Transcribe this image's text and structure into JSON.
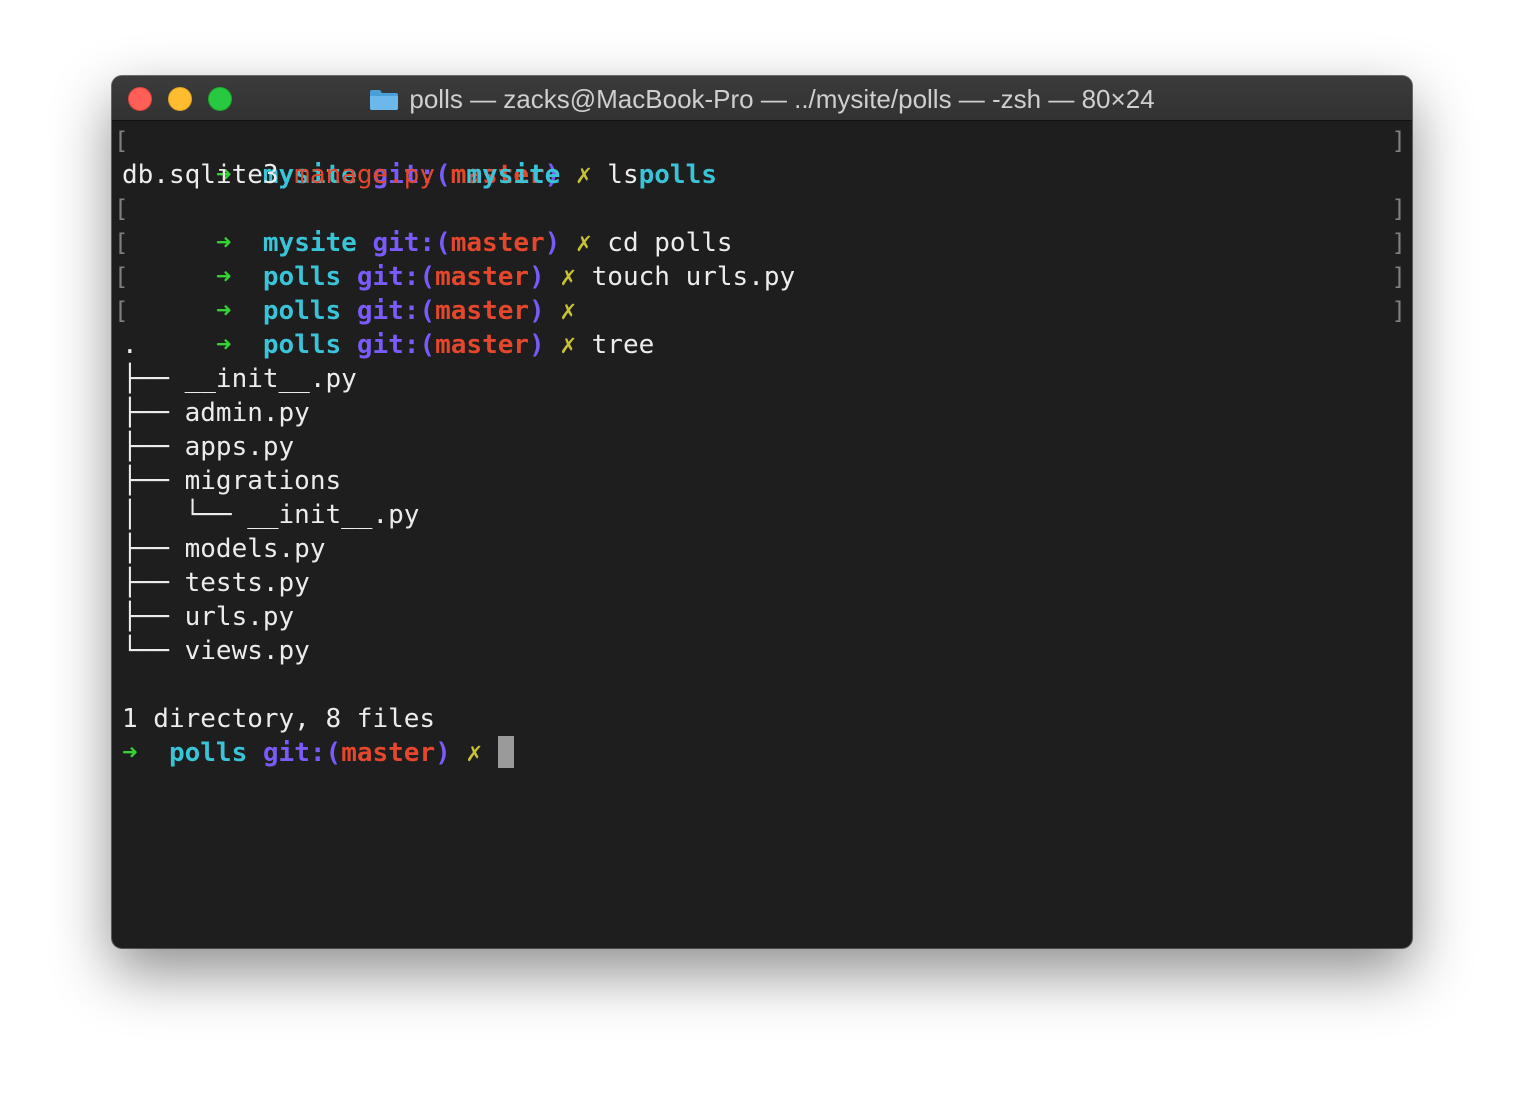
{
  "window": {
    "title": "polls — zacks@MacBook-Pro — ../mysite/polls — -zsh — 80×24",
    "title_icon": "folder-icon"
  },
  "prompt": {
    "arrow": "➜",
    "git_prefix": "git:(",
    "git_suffix": ")",
    "branch": "master",
    "dirty_mark": "✗"
  },
  "lines": [
    {
      "dir": "mysite",
      "cmd": "ls"
    },
    {
      "ls_output": [
        "db.sqlite3",
        "manage.py",
        "mysite",
        "polls"
      ]
    },
    {
      "dir": "mysite",
      "cmd": "cd polls"
    },
    {
      "dir": "polls",
      "cmd": "touch urls.py"
    },
    {
      "dir": "polls",
      "cmd": ""
    },
    {
      "dir": "polls",
      "cmd": "tree"
    }
  ],
  "tree": {
    "root": ".",
    "entries": [
      "├── __init__.py",
      "├── admin.py",
      "├── apps.py",
      "├── migrations",
      "│   └── __init__.py",
      "├── models.py",
      "├── tests.py",
      "├── urls.py",
      "└── views.py"
    ],
    "summary": "1 directory, 8 files"
  },
  "current_prompt": {
    "dir": "polls"
  },
  "colors": {
    "arrow": "#36d136",
    "dir": "#39c4d8",
    "git": "#7a5af8",
    "branch": "#e4472c",
    "dirty": "#c8c236",
    "background": "#1e1e1e"
  }
}
